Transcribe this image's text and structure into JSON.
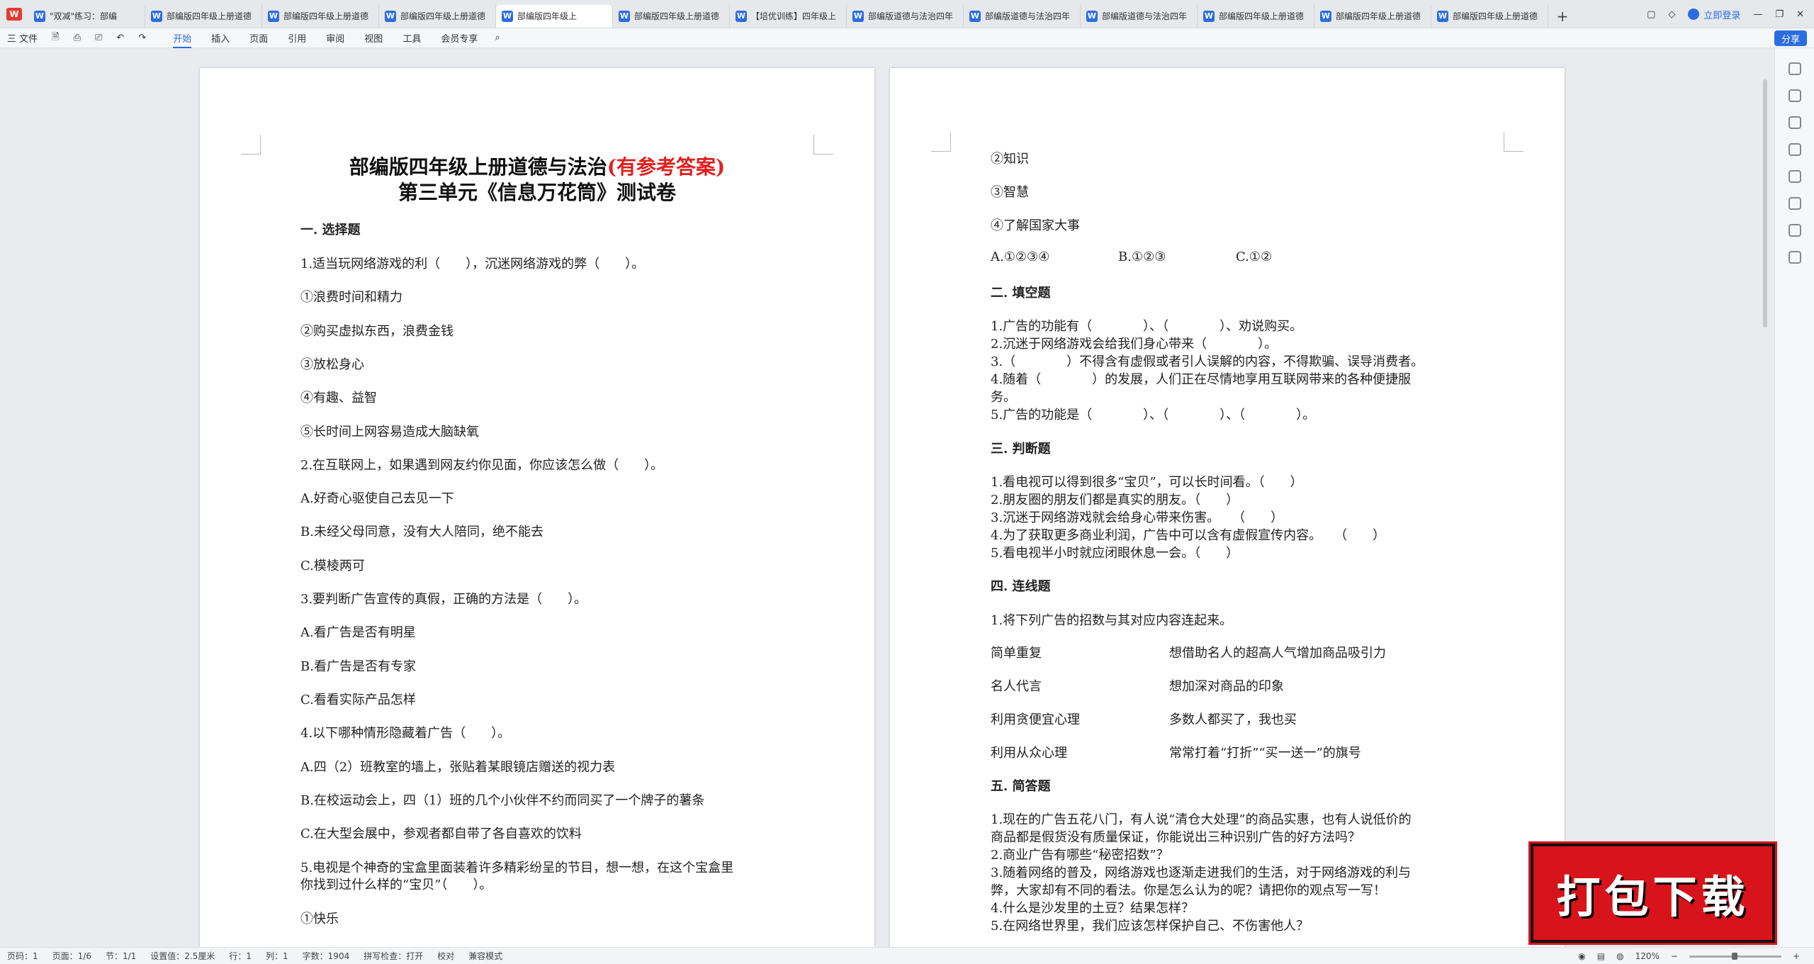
{
  "app": {
    "logo": "W"
  },
  "tabs": [
    {
      "label": "\"双减\"练习：部编"
    },
    {
      "label": "部编版四年级上册道德"
    },
    {
      "label": "部编版四年级上册道德"
    },
    {
      "label": "部编版四年级上册道德"
    },
    {
      "label": "部编版四年级上"
    },
    {
      "label": "部编版四年级上册道德"
    },
    {
      "label": "【培优训练】四年级上"
    },
    {
      "label": "部编版道德与法治四年"
    },
    {
      "label": "部编版道德与法治四年"
    },
    {
      "label": "部编版道德与法治四年"
    },
    {
      "label": "部编版四年级上册道德"
    },
    {
      "label": "部编版四年级上册道德"
    },
    {
      "label": "部编版四年级上册道德"
    }
  ],
  "tab_icon": "W",
  "header_right": {
    "login": "立即登录"
  },
  "toolbar": {
    "file": "三 文件",
    "menus": [
      "开始",
      "插入",
      "页面",
      "引用",
      "审阅",
      "视图",
      "工具",
      "会员专享"
    ],
    "share": "分享"
  },
  "page1": {
    "title_main": "部编版四年级上册道德与法治",
    "title_red": "(有参考答案)",
    "subtitle": "第三单元《信息万花筒》测试卷",
    "section1": "一. 选择题",
    "lines": [
      "1.适当玩网络游戏的利（　　），沉迷网络游戏的弊（　　）。",
      "①浪费时间和精力",
      "②购买虚拟东西，浪费金钱",
      "③放松身心",
      "④有趣、益智",
      "⑤长时间上网容易造成大脑缺氧",
      "2.在互联网上，如果遇到网友约你见面，你应该怎么做（　　）。",
      "A.好奇心驱使自己去见一下",
      "B.未经父母同意，没有大人陪同，绝不能去",
      "C.模棱两可",
      "3.要判断广告宣传的真假，正确的方法是（　　）。",
      "A.看广告是否有明星",
      "B.看广告是否有专家",
      "C.看看实际产品怎样",
      "4.以下哪种情形隐藏着广告（　　）。",
      "A.四（2）班教室的墙上，张贴着某眼镜店赠送的视力表",
      "B.在校运动会上，四（1）班的几个小伙伴不约而同买了一个牌子的薯条",
      "C.在大型会展中，参观者都自带了各自喜欢的饮料"
    ],
    "q5_line1": "5.电视是个神奇的宝盒里面装着许多精彩纷呈的节目，想一想，在这个宝盒里",
    "q5_line2": "你找到过什么样的“宝贝”（　　）。",
    "last": "①快乐"
  },
  "page2": {
    "top_lines": [
      "②知识",
      "③智慧",
      "④了解国家大事"
    ],
    "answers": [
      "A.①②③④",
      "B.①②③",
      "C.①②"
    ],
    "section2": "二. 填空题",
    "fill": [
      "1.广告的功能有（　　　　）、（　　　　）、劝说购买。",
      "2.沉迷于网络游戏会给我们身心带来（　　　　）。",
      "3.（　　　　）不得含有虚假或者引人误解的内容，不得欺骗、误导消费者。",
      "4.随着（　　　　）的发展，人们正在尽情地享用互联网带来的各种便捷服",
      "务。",
      "5.广告的功能是（　　　　）、（　　　　）、（　　　　）。"
    ],
    "section3": "三. 判断题",
    "judge": [
      "1.看电视可以得到很多“宝贝”，可以长时间看。（　　）",
      "2.朋友圈的朋友们都是真实的朋友。（　　）",
      "3.沉迷于网络游戏就会给身心带来伤害。　　（　　）",
      "4.为了获取更多商业利润，广告中可以含有虚假宣传内容。　　（　　）",
      "5.看电视半小时就应闭眼休息一会。（　　）"
    ],
    "section4": "四. 连线题",
    "match_intro": "1.将下列广告的招数与其对应内容连起来。",
    "match_left": [
      "简单重复",
      "名人代言",
      "利用贪便宜心理",
      "利用从众心理"
    ],
    "match_right": [
      "想借助名人的超高人气增加商品吸引力",
      "想加深对商品的印象",
      "多数人都买了，我也买",
      "常常打着“打折”“买一送一”的旗号"
    ],
    "section5": "五. 简答题",
    "short": [
      "1.现在的广告五花八门，有人说“清仓大处理”的商品实惠，也有人说低价的",
      "商品都是假货没有质量保证，你能说出三种识别广告的好方法吗？",
      "2.商业广告有哪些“秘密招数”？",
      "3.随着网络的普及，网络游戏也逐渐走进我们的生活，对于网络游戏的利与",
      "弊，大家却有不同的看法。你是怎么认为的呢？请把你的观点写一写！",
      "4.什么是沙发里的土豆？结果怎样？",
      "5.在网络世界里，我们应该怎样保护自己、不伤害他人？"
    ]
  },
  "status": {
    "items": [
      "页码：1",
      "页面：1/6",
      "节：1/1",
      "设置值：2.5厘米",
      "行：1",
      "列：1",
      "字数：1904",
      "拼写检查：打开",
      "校对",
      "兼容模式"
    ],
    "zoom": "120%"
  },
  "banner": {
    "text": "打包下载"
  }
}
